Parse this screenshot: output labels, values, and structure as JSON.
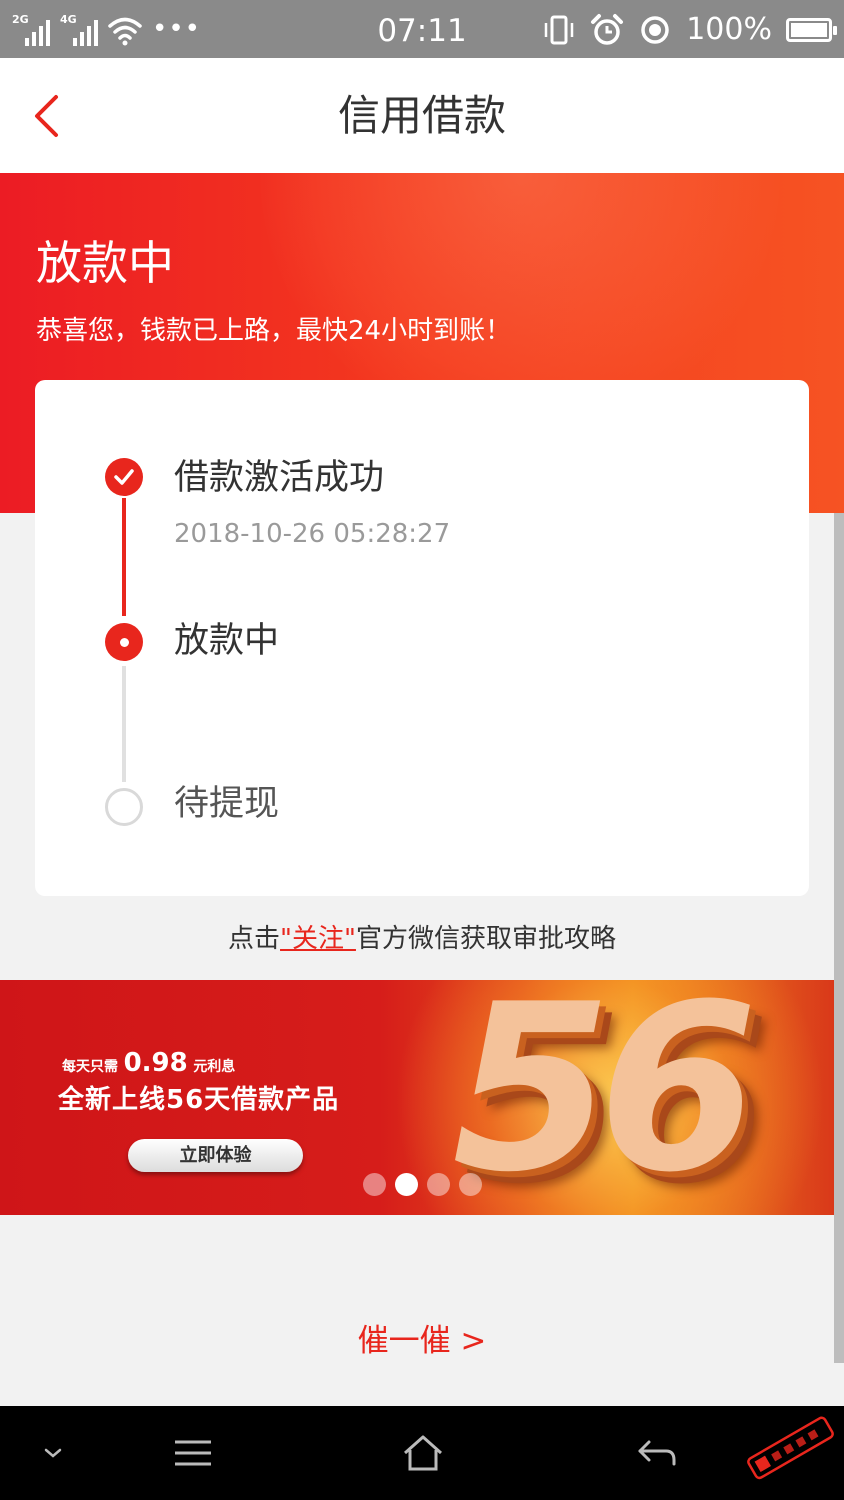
{
  "status_bar": {
    "net1": "2G",
    "net2": "4G",
    "more": "•••",
    "time": "07:11",
    "battery_pct": "100%",
    "battery_level": 1.0
  },
  "header": {
    "title": "信用借款",
    "back_icon": "chevron-left-icon"
  },
  "hero": {
    "title": "放款中",
    "subtitle": "恭喜您，钱款已上路，最快24小时到账！"
  },
  "steps": [
    {
      "label": "借款激活成功",
      "time": "2018-10-26 05:28:27",
      "state": "done"
    },
    {
      "label": "放款中",
      "time": "",
      "state": "active"
    },
    {
      "label": "待提现",
      "time": "",
      "state": "pending"
    }
  ],
  "follow": {
    "prefix": "点击",
    "link": "\"关注\"",
    "suffix": "官方微信获取审批攻略"
  },
  "banner": {
    "line1_a": "每天只需",
    "line1_b": "0.98",
    "line1_c": "元利息",
    "line2": "全新上线56天借款产品",
    "button": "立即体验",
    "big_number": "56",
    "pager_count": 4,
    "pager_active": 1
  },
  "urge": {
    "label": "催一催 >"
  },
  "colors": {
    "accent": "#e8261d",
    "hero_start": "#ec1c24",
    "hero_end": "#f65323",
    "status_bar": "#8a8a8a",
    "nav_bar": "#000000"
  },
  "nav_bar": {
    "icons": [
      "chevron-down-icon",
      "menu-icon",
      "home-icon",
      "back-arrow-icon"
    ]
  }
}
